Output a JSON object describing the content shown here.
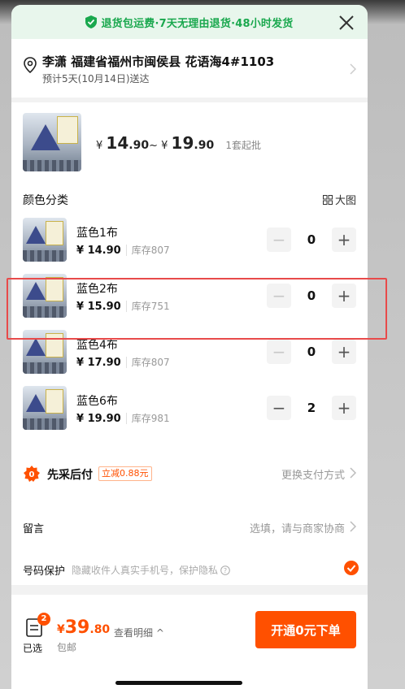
{
  "promo": {
    "text": "退货包运费·7天无理由退货·48小时发货",
    "color": "#1aa84e"
  },
  "address": {
    "line": "李潇 福建省福州市闽侯县 花语海4#1103",
    "delivery": "预计5天(10月14日)送达"
  },
  "product": {
    "price_min_int": "14",
    "price_min_dec": ".90",
    "price_max_int": "19",
    "price_max_dec": ".90",
    "currency": "¥",
    "tilde": "~",
    "moq": "1套起批",
    "section_title": "颜色分类",
    "big_pic_label": "大图",
    "variants": [
      {
        "name": "蓝色1布",
        "price": "¥ 14.90",
        "stock": "库存807",
        "qty": "0"
      },
      {
        "name": "蓝色2布",
        "price": "¥ 15.90",
        "stock": "库存751",
        "qty": "0"
      },
      {
        "name": "蓝色4布",
        "price": "¥ 17.90",
        "stock": "库存807",
        "qty": "0"
      },
      {
        "name": "蓝色6布",
        "price": "¥ 19.90",
        "stock": "库存981",
        "qty": "2"
      }
    ],
    "minus": "−",
    "plus": "+"
  },
  "payment": {
    "title": "先采后付",
    "badge": "立减0.88元",
    "change": "更换支付方式"
  },
  "message": {
    "label": "留言",
    "hint": "选填，请与商家协商",
    "protect_label": "号码保护",
    "protect_hint": "隐藏收件人真实手机号，保护隐私"
  },
  "bottom": {
    "badge_count": "2",
    "selected_label": "已选",
    "currency": "¥",
    "total_int": "39",
    "total_dec": ".80",
    "detail": "查看明细 ^",
    "shipping": "包邮",
    "cta": "开通0元下单"
  },
  "colors": {
    "accent": "#ff5000",
    "highlight": "#e84a4a"
  }
}
